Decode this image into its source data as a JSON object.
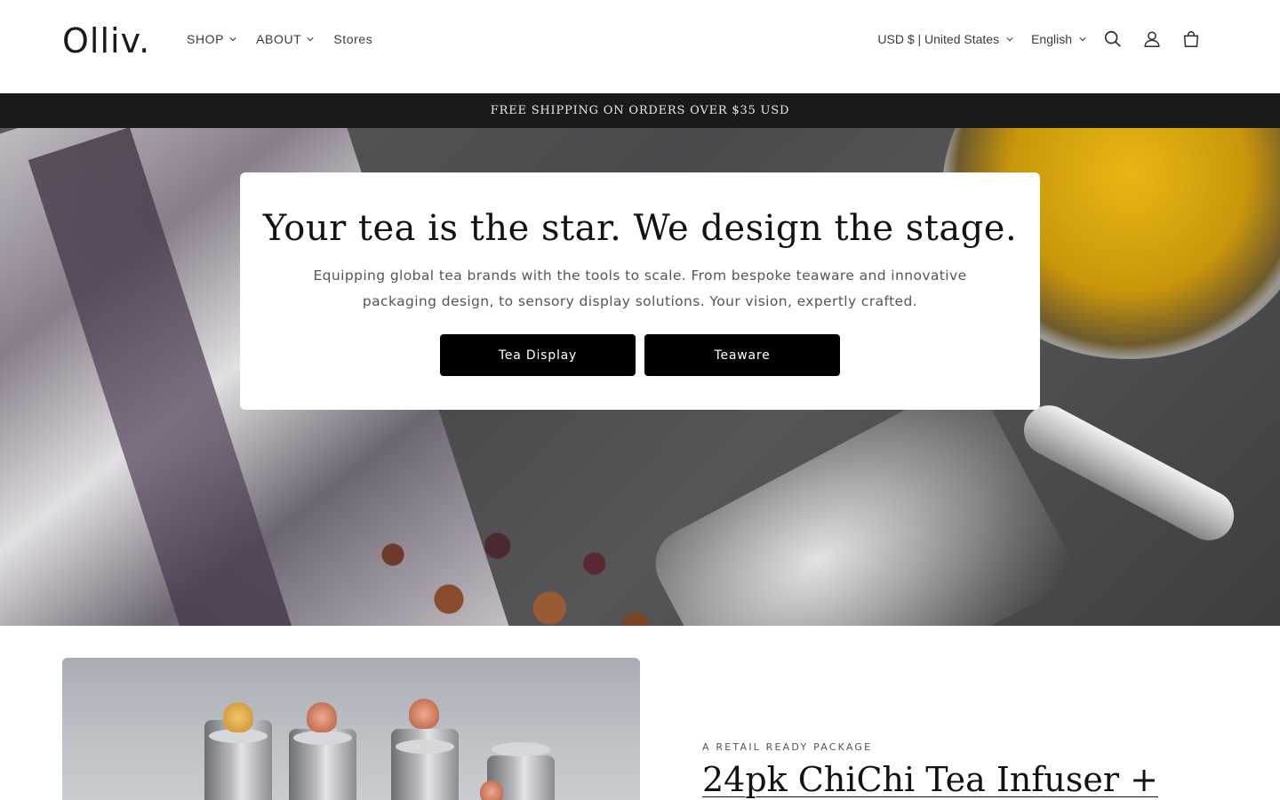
{
  "header": {
    "logo": "Olliv.",
    "nav": [
      {
        "label": "SHOP",
        "has_dropdown": true
      },
      {
        "label": "ABOUT",
        "has_dropdown": true
      },
      {
        "label": "Stores",
        "has_dropdown": false
      }
    ],
    "currency": "USD $ | United States",
    "language": "English",
    "icons": [
      "search-icon",
      "account-icon",
      "cart-icon"
    ]
  },
  "announcement": {
    "text": "FREE SHIPPING ON ORDERS OVER $35 USD"
  },
  "hero": {
    "title": "Your tea is the star. We design the stage.",
    "subtitle": "Equipping global tea brands with the tools to scale. From bespoke teaware and innovative packaging design, to sensory display solutions. Your vision, expertly crafted.",
    "buttons": [
      {
        "label": "Tea Display"
      },
      {
        "label": "Teaware"
      }
    ]
  },
  "feature": {
    "eyebrow": "A RETAIL READY PACKAGE",
    "title": "24pk ChiChi Tea Infuser +"
  },
  "colors": {
    "announcement_bg": "#1a1a1a",
    "button_bg": "#000000",
    "text": "#121212"
  }
}
